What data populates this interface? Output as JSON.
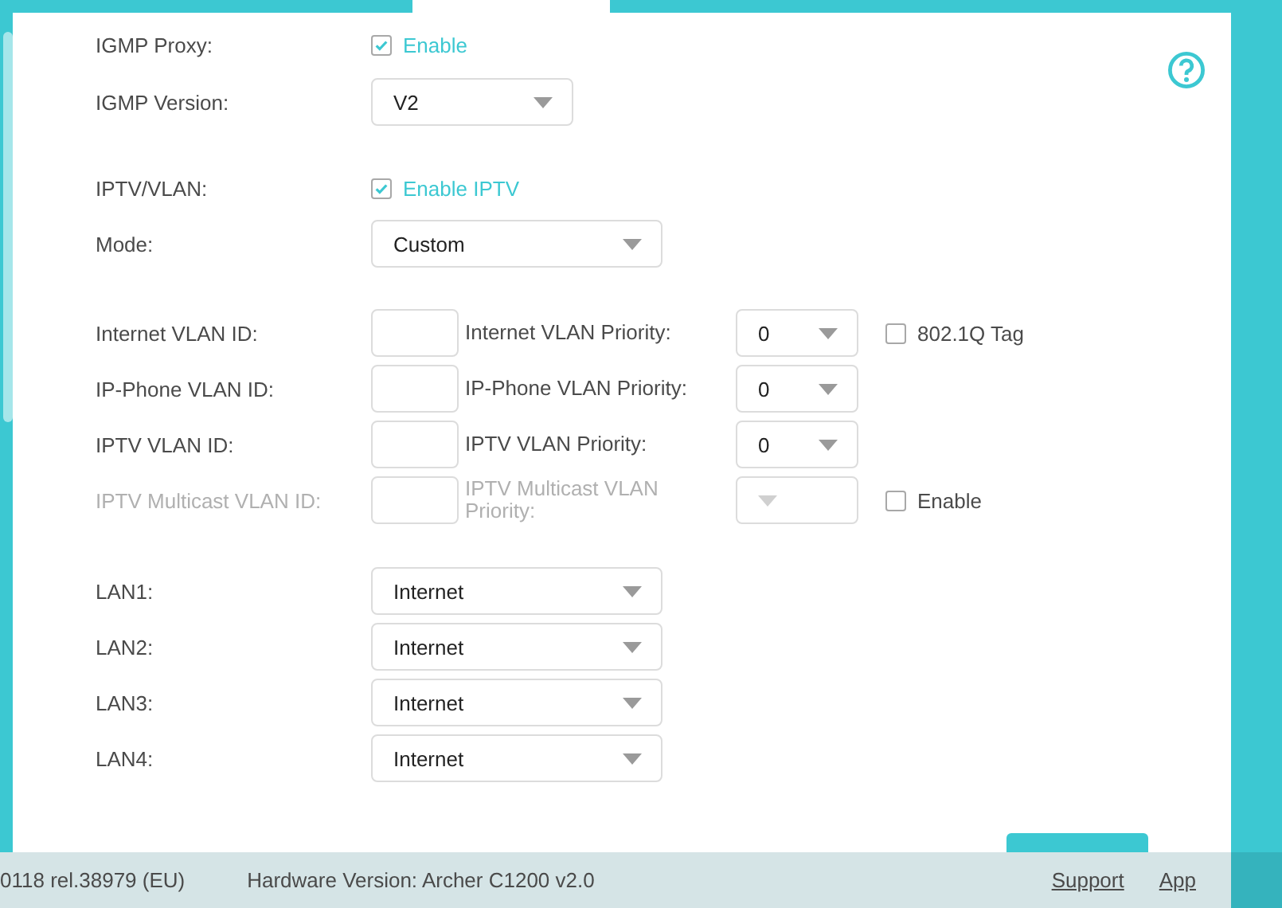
{
  "igmp": {
    "proxy_label": "IGMP Proxy:",
    "proxy_checkbox": {
      "label": "Enable",
      "checked": true
    },
    "version_label": "IGMP Version:",
    "version": "V2"
  },
  "iptv": {
    "label": "IPTV/VLAN:",
    "checkbox": {
      "label": "Enable IPTV",
      "checked": true
    },
    "mode_label": "Mode:",
    "mode": "Custom"
  },
  "vlan_rows": [
    {
      "id_label": "Internet VLAN ID:",
      "priority_label": "Internet VLAN Priority:",
      "priority": "0",
      "disabled": false,
      "checkbox": {
        "label": "802.1Q Tag",
        "checked": false
      }
    },
    {
      "id_label": "IP-Phone VLAN ID:",
      "priority_label": "IP-Phone VLAN Priority:",
      "priority": "0",
      "disabled": false
    },
    {
      "id_label": "IPTV VLAN ID:",
      "priority_label": "IPTV VLAN Priority:",
      "priority": "0",
      "disabled": false
    },
    {
      "id_label": "IPTV Multicast VLAN ID:",
      "priority_label": "IPTV Multicast VLAN Priority:",
      "disabled": true,
      "checkbox": {
        "label": "Enable",
        "checked": false
      }
    }
  ],
  "lan_rows": [
    {
      "label": "LAN1:",
      "value": "Internet"
    },
    {
      "label": "LAN2:",
      "value": "Internet"
    },
    {
      "label": "LAN3:",
      "value": "Internet"
    },
    {
      "label": "LAN4:",
      "value": "Internet"
    }
  ],
  "footer": {
    "firmware": "0118 rel.38979 (EU)",
    "hardware": "Hardware Version: Archer C1200 v2.0",
    "links": [
      "Support",
      "App"
    ]
  }
}
